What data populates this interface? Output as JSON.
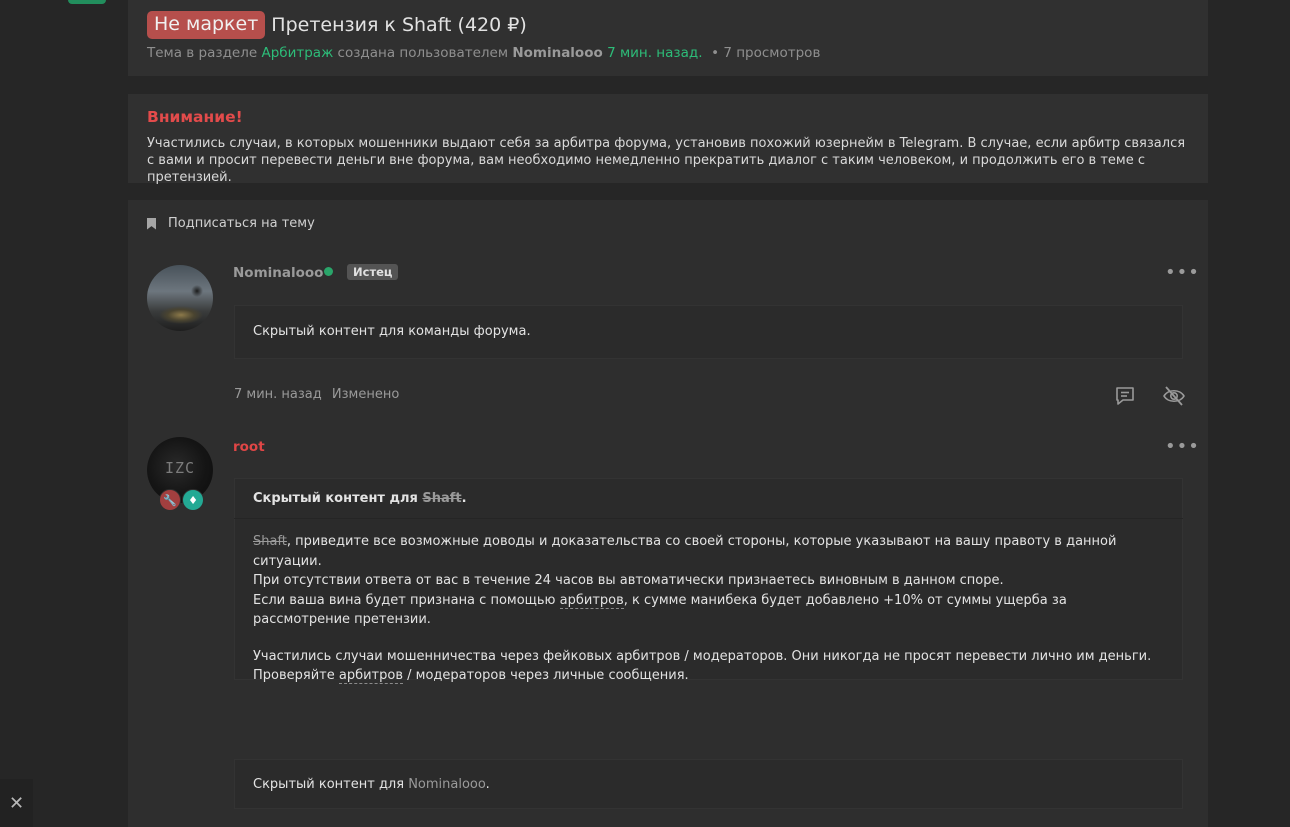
{
  "thread": {
    "prefix": "Не маркет",
    "title": "Претензия к Shaft (420 ₽)",
    "meta": {
      "prefix_text": "Тема в разделе",
      "section": "Арбитраж",
      "created_by_text": "создана пользователем",
      "author": "Nominalooo",
      "time": "7 мин. назад.",
      "views": "• 7 просмотров"
    }
  },
  "warning": {
    "title": "Внимание!",
    "text": "Участились случаи, в которых мошенники выдают себя за арбитра форума, установив похожий юзернейм в Telegram. В случае, если арбитр связался с вами и просит перевести деньги вне форума, вам необходимо немедленно прекратить диалог с таким человеком, и продолжить его в теме с претензией."
  },
  "subscribe_label": "Подписаться на тему",
  "posts": [
    {
      "username": "Nominalooo",
      "role": "Истец",
      "content": "Скрытый контент для команды форума.",
      "time": "7 мин. назад",
      "edited": "Изменено"
    },
    {
      "username": "root",
      "avatar_text": "IZC",
      "hidden_head_prefix": "Скрытый контент для",
      "hidden_head_user": "Shaft",
      "hidden_head_suffix": ".",
      "body": {
        "line1_user": "Shaft",
        "line1_rest": ", приведите все возможные доводы и доказательства со своей стороны, которые указывают на вашу правоту в данной ситуации.",
        "line2": "При отсутствии ответа от вас в течение 24 часов вы автоматически признаетесь виновным в данном споре.",
        "line3_a": "Если ваша вина будет признана с помощью ",
        "line3_link": "арбитров",
        "line3_b": ", к сумме манибека будет добавлено +10% от суммы ущерба за рассмотрение претензии.",
        "line4": "Участились случаи мошенничества через фейковых арбитров / модераторов. Они никогда не просят перевести лично им деньги.",
        "line5_a": "Проверяйте ",
        "line5_link": "арбитров",
        "line5_b": " / модераторов через личные сообщения."
      },
      "hidden2_prefix": "Скрытый контент для",
      "hidden2_user": "Nominalooo",
      "hidden2_suffix": "."
    }
  ],
  "colors": {
    "accent_green": "#2dbd79",
    "prefix_red": "#b64f4c",
    "warning_red": "#e34b4b",
    "admin_red": "#e04646"
  }
}
